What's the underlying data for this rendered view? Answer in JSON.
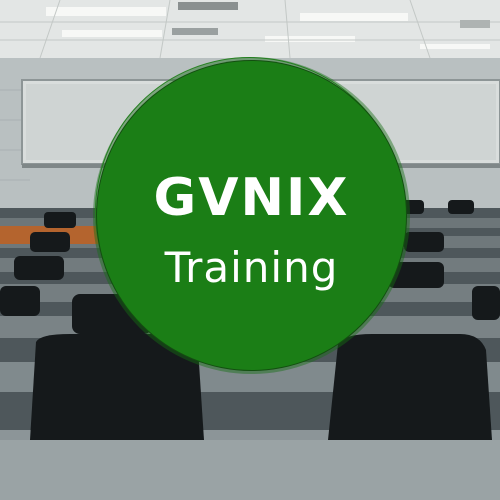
{
  "logo": {
    "title": "GVNIX",
    "subtitle": "Training",
    "circle_color": "#1b7e16",
    "text_color": "#ffffff"
  }
}
